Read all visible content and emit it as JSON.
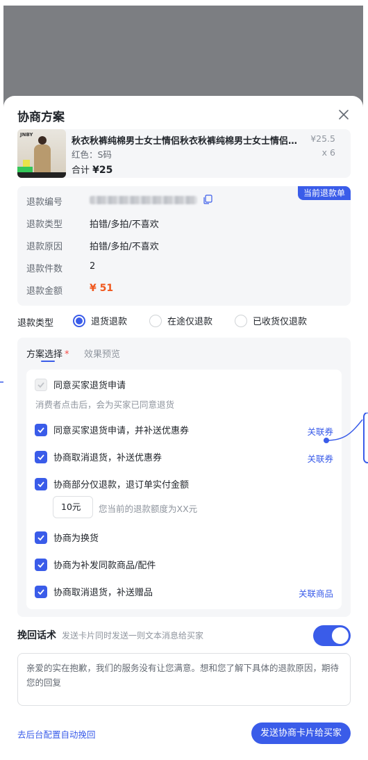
{
  "sheet": {
    "title": "协商方案"
  },
  "product": {
    "image_brand": "JNBY",
    "name": "秋衣秋裤纯棉男士女士情侣秋衣秋裤纯棉男士女士情侣保暖内衣套装",
    "sku": "红色：S码",
    "total_label": "合计",
    "total_value": "¥25",
    "price": "¥25.5",
    "quantity": "x 6"
  },
  "refund_info": {
    "tag": "当前退款单",
    "rows": [
      {
        "label": "退款编号",
        "value": ""
      },
      {
        "label": "退款类型",
        "value": "拍错/多拍/不喜欢"
      },
      {
        "label": "退款原因",
        "value": "拍错/多拍/不喜欢"
      },
      {
        "label": "退款件数",
        "value": "2"
      },
      {
        "label": "退款金额",
        "value": "¥ 51"
      }
    ]
  },
  "refund_type": {
    "label": "退款类型",
    "options": [
      "退货退款",
      "在途仅退款",
      "已收货仅退款"
    ],
    "selected": 0
  },
  "plan": {
    "tab_active": "方案选择",
    "required_mark": "*",
    "tab_idle": "效果预览",
    "options": [
      {
        "label": "同意买家退货申请",
        "checked": true,
        "disabled": true,
        "desc": "消费者点击后，会为买家已同意退货",
        "link": ""
      },
      {
        "label": "同意买家退货申请，并补送优惠券",
        "checked": true,
        "link": "关联券"
      },
      {
        "label": "协商取消退货，补送优惠券",
        "checked": true,
        "link": "关联券"
      },
      {
        "label": "协商部分仅退款，退订单实付金额",
        "checked": true,
        "link": ""
      },
      {
        "label": "协商为换货",
        "checked": true,
        "link": ""
      },
      {
        "label": "协商为补发同款商品/配件",
        "checked": true,
        "link": ""
      },
      {
        "label": "协商取消退货，补送赠品",
        "checked": true,
        "link": "关联商品"
      }
    ],
    "amount_value": "10元",
    "amount_hint": "您当前的退款额度为XX元"
  },
  "retention": {
    "title": "挽回话术",
    "subtitle": "发送卡片同时发送一则文本消息给买家",
    "enabled": true,
    "message": "亲爱的实在抱歉，我们的服务没有让您满意。想和您了解下具体的退款原因，期待您的回复"
  },
  "footer": {
    "config_link": "去后台配置自动挽回",
    "send_button": "发送协商卡片给买家"
  },
  "colors": {
    "accent": "#3a5ce9",
    "amount": "#f0581e",
    "required": "#f54a45"
  }
}
